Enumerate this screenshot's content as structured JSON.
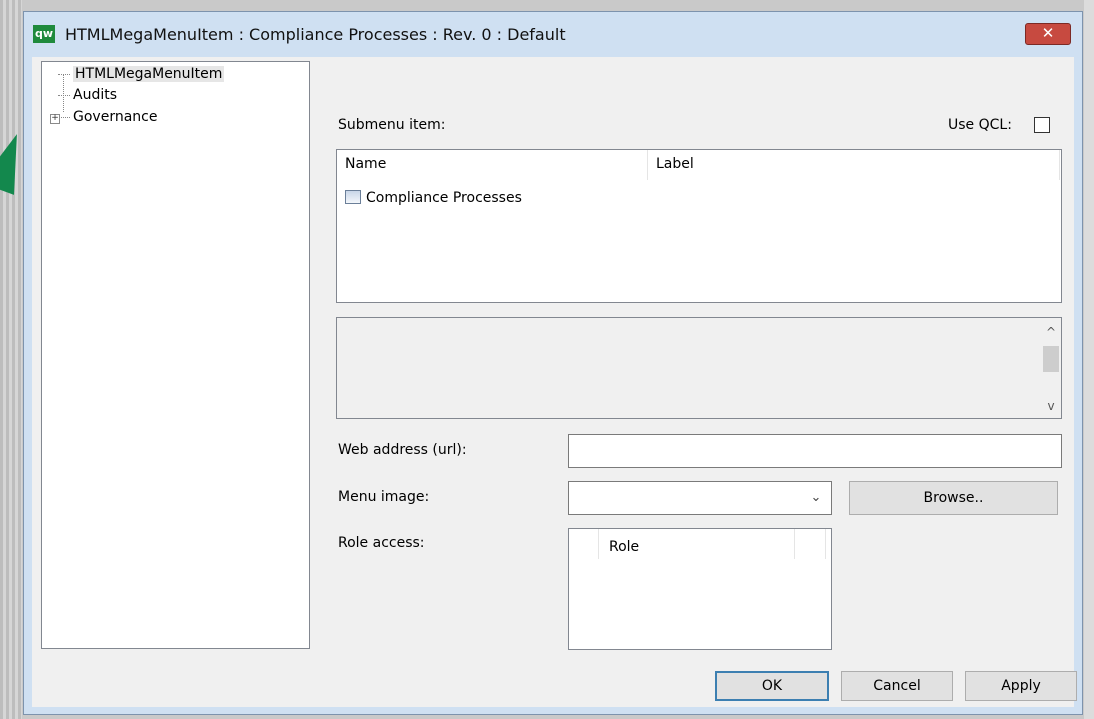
{
  "window": {
    "app_icon_text": "qw",
    "title": "HTMLMegaMenuItem : Compliance Processes : Rev. 0  : Default",
    "close_symbol": "✕"
  },
  "tree": {
    "items": [
      {
        "label": "HTMLMegaMenuItem",
        "selected": true
      },
      {
        "label": "Audits"
      },
      {
        "label": "Governance",
        "expander": "+"
      }
    ]
  },
  "form": {
    "submenu_label": "Submenu item:",
    "use_qcl_label": "Use QCL:",
    "use_qcl_checked": false,
    "grid": {
      "columns": [
        "Name",
        "Label"
      ],
      "rows": [
        {
          "name": "Compliance Processes",
          "label": "",
          "icon": "table-icon"
        }
      ]
    },
    "scroll_up": "^",
    "scroll_down": "v",
    "web_address_label": "Web address (url):",
    "web_address_value": "",
    "menu_image_label": "Menu image:",
    "menu_image_value": "",
    "browse_label": "Browse..",
    "role_access_label": "Role access:",
    "role_columns": [
      "Role"
    ]
  },
  "buttons": {
    "ok": "OK",
    "cancel": "Cancel",
    "apply": "Apply"
  },
  "colors": {
    "accent_green": "#13884d",
    "title_bar": "#cfe0f2",
    "close_red": "#c74a40",
    "default_button_border": "#3c7fb1"
  }
}
